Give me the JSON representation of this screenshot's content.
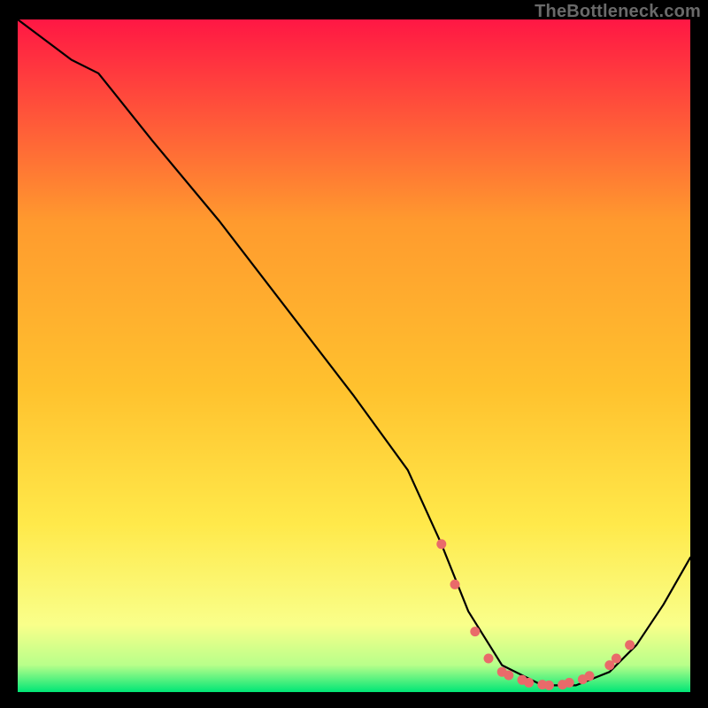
{
  "watermark": "TheBottleneck.com",
  "chart_data": {
    "type": "line",
    "title": "",
    "xlabel": "",
    "ylabel": "",
    "xlim": [
      0,
      100
    ],
    "ylim": [
      0,
      100
    ],
    "gradient_colors": {
      "top": "#ff1744",
      "upper_mid": "#ff9a2e",
      "mid": "#ffe94a",
      "lower_mid": "#f9ff8a",
      "near_bottom": "#b8ff8a",
      "bottom": "#00e676"
    },
    "series": [
      {
        "name": "bottleneck-curve",
        "x": [
          0,
          8,
          12,
          20,
          30,
          40,
          50,
          58,
          63,
          67,
          72,
          78,
          83,
          88,
          92,
          96,
          100
        ],
        "y": [
          100,
          94,
          92,
          82,
          70,
          57,
          44,
          33,
          22,
          12,
          4,
          1,
          1,
          3,
          7,
          13,
          20
        ]
      }
    ],
    "highlight_dots": {
      "name": "optimal-range-dots",
      "points": [
        {
          "x": 63,
          "y": 22
        },
        {
          "x": 65,
          "y": 16
        },
        {
          "x": 68,
          "y": 9
        },
        {
          "x": 70,
          "y": 5
        },
        {
          "x": 72,
          "y": 3
        },
        {
          "x": 73,
          "y": 2.5
        },
        {
          "x": 75,
          "y": 1.8
        },
        {
          "x": 76,
          "y": 1.4
        },
        {
          "x": 78,
          "y": 1.1
        },
        {
          "x": 79,
          "y": 1.0
        },
        {
          "x": 81,
          "y": 1.1
        },
        {
          "x": 82,
          "y": 1.4
        },
        {
          "x": 84,
          "y": 1.9
        },
        {
          "x": 85,
          "y": 2.4
        },
        {
          "x": 88,
          "y": 4.0
        },
        {
          "x": 89,
          "y": 5.0
        },
        {
          "x": 91,
          "y": 7.0
        }
      ]
    }
  }
}
